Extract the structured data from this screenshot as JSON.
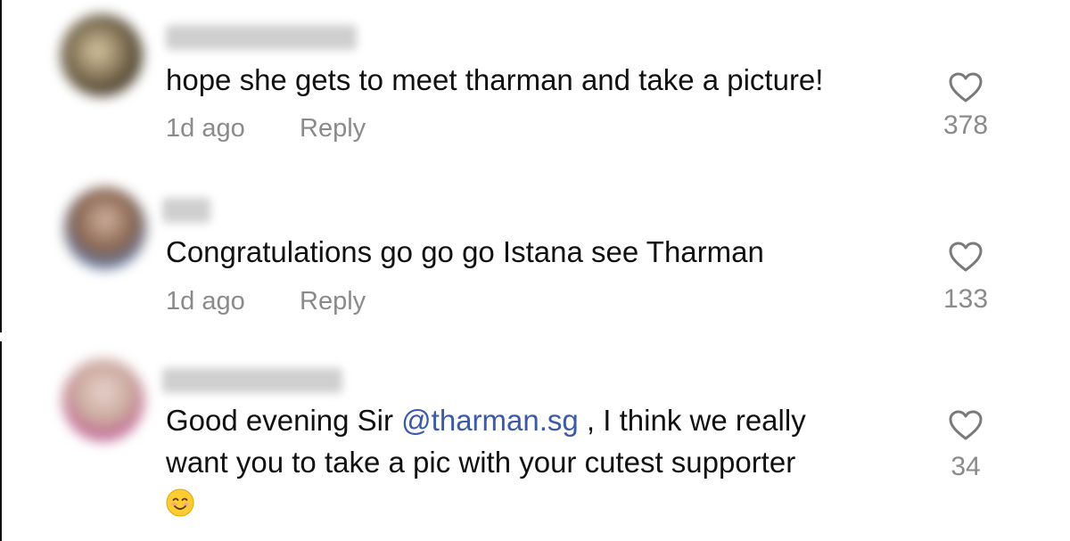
{
  "comments": [
    {
      "text": "hope she gets to meet tharman and take a picture!",
      "time": "1d ago",
      "reply_label": "Reply",
      "likes": "378",
      "avatar_colors": [
        "#6b5a43",
        "#d8c8a2",
        "#3e3426"
      ]
    },
    {
      "text": "Congratulations go go go Istana see Tharman",
      "time": "1d ago",
      "reply_label": "Reply",
      "likes": "133",
      "avatar_colors": [
        "#8a6650",
        "#d3b3a3",
        "#5b7bb0"
      ]
    },
    {
      "text_before": "Good evening Sir ",
      "mention": "@tharman.sg",
      "text_after": " , I think we really",
      "text_line2": "want you to take a pic with your cutest supporter",
      "emoji": "smiling-face-emoji",
      "likes": "34",
      "avatar_colors": [
        "#c9a89c",
        "#e9d3cf",
        "#c04a95"
      ]
    }
  ],
  "colors": {
    "text": "#111111",
    "muted": "#8a8a8a",
    "mention": "#3b5aa8"
  },
  "icons": {
    "like": "heart-outline-icon"
  }
}
